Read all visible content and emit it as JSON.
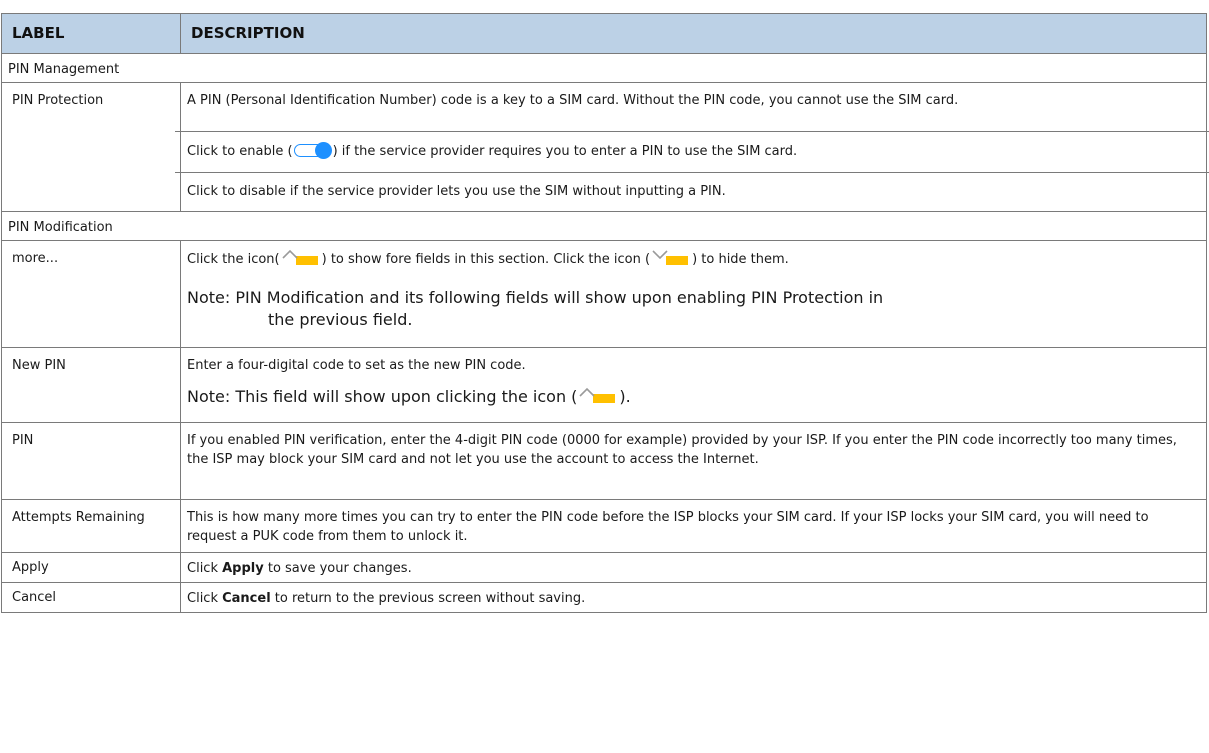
{
  "header": {
    "label_col": "LABEL",
    "description_col": "DESCRIPTION"
  },
  "sections": {
    "pin_management": "PIN Management",
    "pin_modification": "PIN Modification"
  },
  "rows": {
    "pin_protection": {
      "label": "PIN Protection",
      "p1": "A PIN (Personal Identification Number) code is a key to a SIM card. Without the PIN code, you cannot use the SIM card.",
      "p2_a": "Click to enable (",
      "p2_b": ") if the service provider requires you to enter a PIN to use the SIM card.",
      "p3": "Click to disable if the service provider lets you use the SIM without inputting a PIN."
    },
    "more": {
      "label": "more...",
      "p1_a": "Click the icon(",
      "p1_b": ") to show fore fields in this section. Click the icon (",
      "p1_c": ") to hide them.",
      "note_lead": "Note: PIN Modification and its following fields will show upon enabling PIN Protection in",
      "note_cont": "the previous field."
    },
    "new_pin": {
      "label": "New PIN",
      "p1": "Enter a four-digital code to set as the new PIN code.",
      "note_a": "Note: This field will show upon clicking the icon (",
      "note_b": ")."
    },
    "pin": {
      "label": "PIN",
      "p1": "If you enabled PIN verification, enter the 4-digit PIN code (0000 for example) provided by your ISP. If you enter the PIN code incorrectly too many times, the ISP may block your SIM card and not let you use the account to access the Internet."
    },
    "attempts": {
      "label": "Attempts Remaining",
      "p1": "This is how many more times you can try to enter the PIN code before the ISP blocks your SIM card. If your ISP locks your SIM card, you will need to request a PUK code from them to unlock it."
    },
    "apply": {
      "label": "Apply",
      "p_a": "Click ",
      "p_bold": "Apply",
      "p_b": " to save your changes."
    },
    "cancel": {
      "label": "Cancel",
      "p_a": "Click ",
      "p_bold": "Cancel",
      "p_b": " to return to the previous screen without saving."
    }
  },
  "icons": {
    "toggle": "toggle-on-icon",
    "show_more": "chevron-up-folder-icon",
    "hide_more": "chevron-down-folder-icon",
    "toggle_color": "#1e90ff",
    "folder_color": "#ffc000"
  }
}
